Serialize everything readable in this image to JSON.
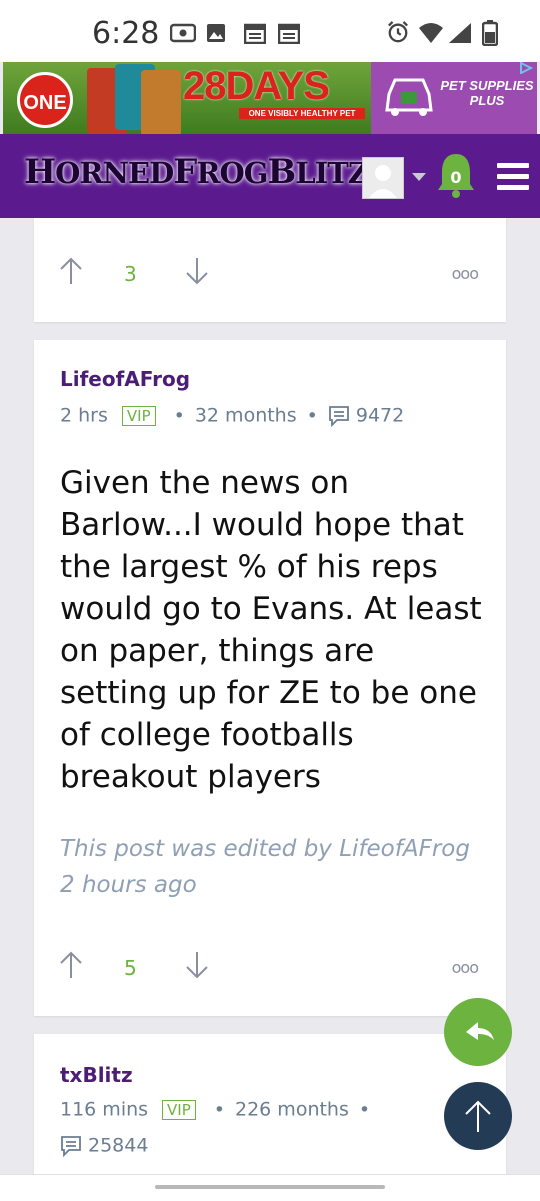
{
  "status_bar": {
    "time": "6:28"
  },
  "ad": {
    "brand_logo": "ONE",
    "headline": "28DAYS",
    "tagline": "ONE VISIBLY HEALTHY PET",
    "sponsor_lines": [
      "PET SUPPLIES",
      "PLUS"
    ],
    "colors": {
      "red": "#d9231b",
      "purple": "#9c4bb0",
      "grass": "#6fa43a"
    }
  },
  "header": {
    "site_name_parts": [
      "H",
      "ORNED",
      "F",
      "ROG",
      "B",
      "LITZ"
    ],
    "notification_count": "0",
    "colors": {
      "bar": "#5b1a8e",
      "bell": "#6db33f"
    }
  },
  "posts": [
    {
      "votes": "3"
    },
    {
      "author": "LifeofAFrog",
      "time": "2 hrs",
      "badge": "VIP",
      "tenure": "32 months",
      "post_count": "9472",
      "body": "Given the news on Barlow...I would hope that the largest % of his reps would go to Evans. At least on paper, things are setting up for ZE to be one of college footballs breakout players",
      "edited_note": "This post was edited by LifeofAFrog 2 hours ago",
      "votes": "5"
    },
    {
      "author": "txBlitz",
      "time": "116 mins",
      "badge": "VIP",
      "tenure": "226 months",
      "post_count": "25844"
    }
  ],
  "more_label": "ooo",
  "meta_separator": "•"
}
